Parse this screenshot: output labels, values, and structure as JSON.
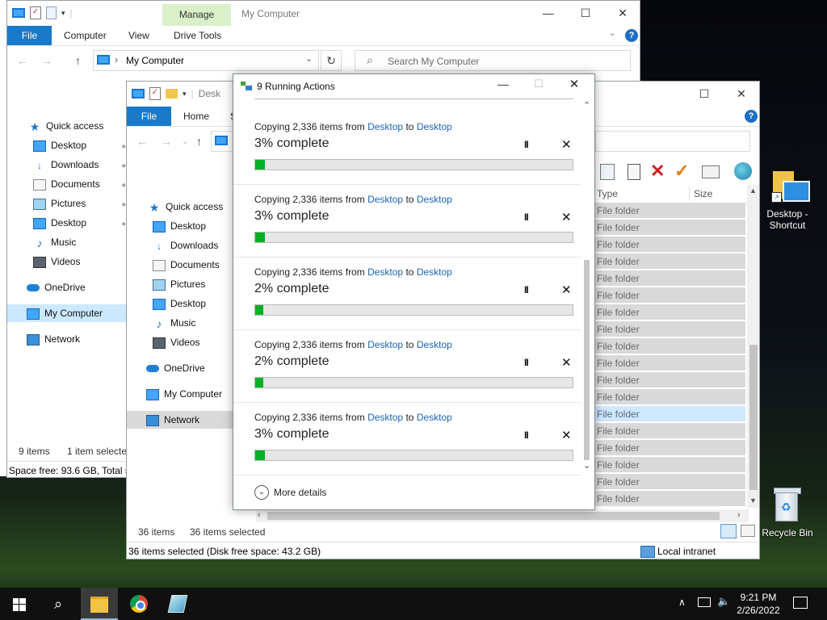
{
  "window1": {
    "manage_tab": "Manage",
    "title": "My Computer",
    "tabs": [
      "File",
      "Computer",
      "View",
      "Drive Tools"
    ],
    "address": "My Computer",
    "search_placeholder": "Search My Computer",
    "sidebar": [
      "Quick access",
      "Desktop",
      "Downloads",
      "Documents",
      "Pictures",
      "Desktop",
      "Music",
      "Videos",
      "OneDrive",
      "My Computer",
      "Network"
    ],
    "status_items": "9 items",
    "status_selected": "1 item selected",
    "space_free": "Space free: 93.6 GB, Total siz"
  },
  "window2": {
    "title_partial": "Desk",
    "tabs": [
      "File",
      "Home",
      "S"
    ],
    "sidebar": [
      "Quick access",
      "Desktop",
      "Downloads",
      "Documents",
      "Pictures",
      "Desktop",
      "Music",
      "Videos",
      "OneDrive",
      "My Computer",
      "Network"
    ],
    "columns": {
      "type": "Type",
      "size": "Size"
    },
    "rows": [
      "File folder",
      "File folder",
      "File folder",
      "File folder",
      "File folder",
      "File folder",
      "File folder",
      "File folder",
      "File folder",
      "File folder",
      "File folder",
      "File folder",
      "File folder",
      "File folder",
      "File folder",
      "File folder",
      "File folder",
      "File folder"
    ],
    "selected_row": 12,
    "status_items": "36 items",
    "status_selected": "36 items selected",
    "bottom_status": "36 items selected (Disk free space: 43.2 GB)",
    "zone": "Local intranet"
  },
  "dialog": {
    "title": "9 Running Actions",
    "operations": [
      {
        "prefix": "Copying 2,336 items from",
        "from": "Desktop",
        "mid": "to",
        "to": "Desktop",
        "percent_text": "3% complete",
        "progress": 3
      },
      {
        "prefix": "Copying 2,336 items from",
        "from": "Desktop",
        "mid": "to",
        "to": "Desktop",
        "percent_text": "3% complete",
        "progress": 3
      },
      {
        "prefix": "Copying 2,336 items from",
        "from": "Desktop",
        "mid": "to",
        "to": "Desktop",
        "percent_text": "2% complete",
        "progress": 2
      },
      {
        "prefix": "Copying 2,336 items from",
        "from": "Desktop",
        "mid": "to",
        "to": "Desktop",
        "percent_text": "2% complete",
        "progress": 2
      },
      {
        "prefix": "Copying 2,336 items from",
        "from": "Desktop",
        "mid": "to",
        "to": "Desktop",
        "percent_text": "3% complete",
        "progress": 3
      }
    ],
    "pause_glyph": "II",
    "cancel_glyph": "✕",
    "more_details": "More details"
  },
  "desktop": {
    "shortcut_label": "Desktop - Shortcut",
    "recycle_label": "Recycle Bin"
  },
  "taskbar": {
    "time": "9:21 PM",
    "date": "2/26/2022"
  },
  "colors": {
    "accent": "#1979ca",
    "progress_fill": "#06b025",
    "link": "#1b65b5"
  }
}
